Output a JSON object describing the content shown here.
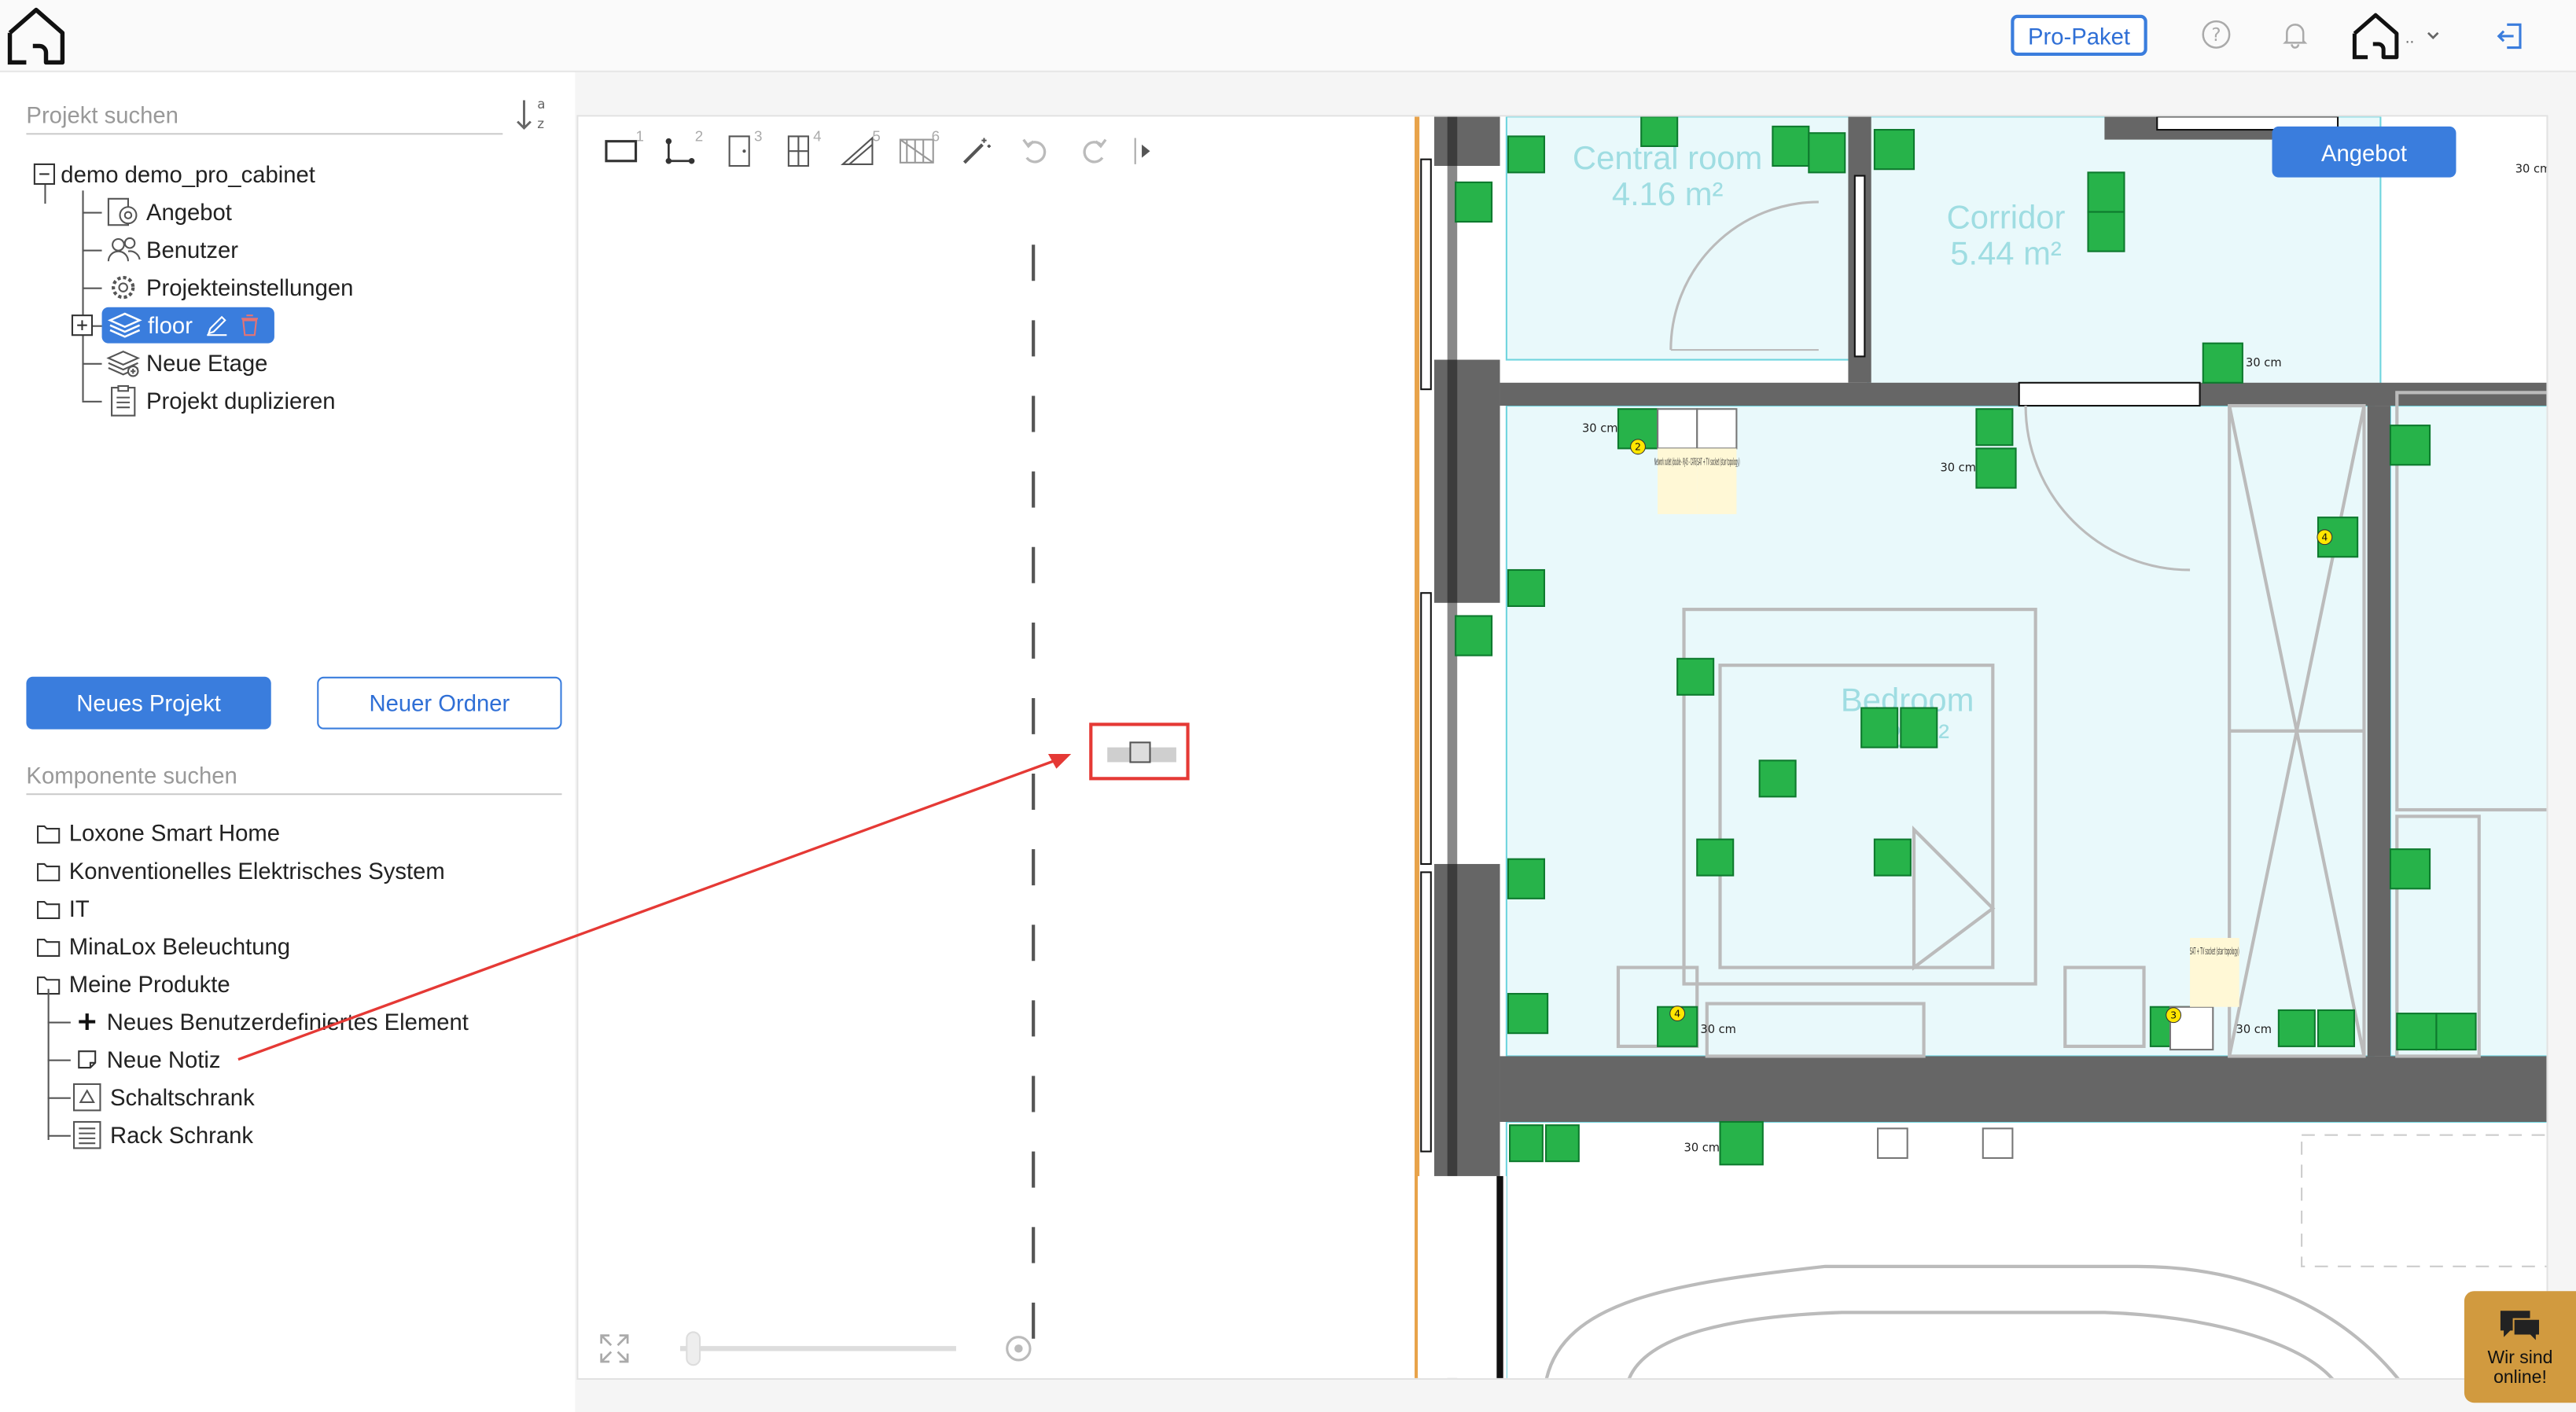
{
  "header": {
    "pro_label": "Pro-Paket",
    "user_suffix": ".."
  },
  "sidebar": {
    "project_search_placeholder": "Projekt suchen",
    "sort_top": "a",
    "sort_bottom": "z",
    "tree": {
      "root": "demo demo_pro_cabinet",
      "items": [
        "Angebot",
        "Benutzer",
        "Projekteinstellungen",
        "floor",
        "Neue Etage",
        "Projekt duplizieren"
      ]
    },
    "new_project": "Neues Projekt",
    "new_folder": "Neuer Ordner",
    "component_search_placeholder": "Komponente suchen",
    "folders": [
      "Loxone Smart Home",
      "Konventionelles Elektrisches System",
      "IT",
      "MinaLox Beleuchtung",
      "Meine Produkte"
    ],
    "products": [
      "Neues Benutzerdefiniertes Element",
      "Neue Notiz",
      "Schaltschrank",
      "Rack Schrank"
    ]
  },
  "toolbar": {
    "shortcuts": [
      "1",
      "2",
      "3",
      "4",
      "5",
      "6"
    ]
  },
  "floorplan": {
    "rooms": [
      {
        "name": "Central room",
        "area": "4.16 m²"
      },
      {
        "name": "Corridor",
        "area": "5.44 m²"
      },
      {
        "name": "Bedroom",
        "area": "12 m²"
      }
    ],
    "dimension_label": "30 cm",
    "badges": [
      "2",
      "4",
      "3"
    ],
    "notes": [
      "Network outlet (double - RJ45 - CAT6)",
      "SAT + TV socket (star topology)",
      "SAT + TV socket (star topology)"
    ]
  },
  "angebot_label": "Angebot",
  "chat": {
    "line1": "Wir sind",
    "line2": "online!"
  },
  "colors": {
    "accent": "#3a7ddd",
    "device_green": "#27b34a",
    "room_fill": "#e9f9fb",
    "wall": "#666666",
    "annotation_red": "#e53935",
    "chat_bg": "#d19a3f"
  }
}
